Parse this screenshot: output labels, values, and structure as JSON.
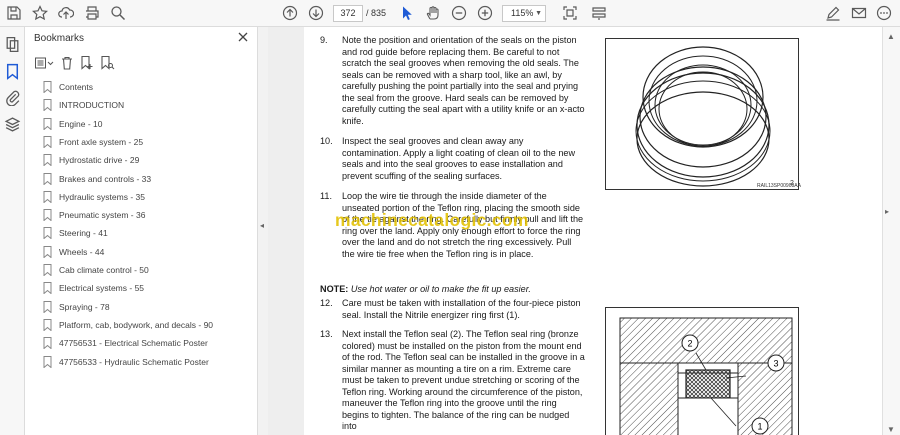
{
  "toolbar": {
    "page_current": "372",
    "page_total": "/ 835",
    "zoom": "115%"
  },
  "sidebar": {
    "title": "Bookmarks",
    "items": [
      {
        "label": "Contents"
      },
      {
        "label": "INTRODUCTION"
      },
      {
        "label": "Engine - 10"
      },
      {
        "label": "Front axle system - 25"
      },
      {
        "label": "Hydrostatic drive - 29"
      },
      {
        "label": "Brakes and controls - 33"
      },
      {
        "label": "Hydraulic systems - 35"
      },
      {
        "label": "Pneumatic system - 36"
      },
      {
        "label": "Steering - 41"
      },
      {
        "label": "Wheels - 44"
      },
      {
        "label": "Cab climate control - 50"
      },
      {
        "label": "Electrical systems - 55"
      },
      {
        "label": "Spraying - 78"
      },
      {
        "label": "Platform, cab, bodywork, and decals - 90"
      },
      {
        "label": "47756531 - Electrical Schematic Poster"
      },
      {
        "label": "47756533 - Hydraulic Schematic Poster"
      }
    ]
  },
  "document": {
    "steps": [
      {
        "num": "9.",
        "text": "Note the position and orientation of the seals on the piston and rod guide before replacing them. Be careful to not scratch the seal grooves when removing the old seals. The seals can be removed with a sharp tool, like an awl, by carefully pushing the point partially into the seal and prying the seal from the groove. Hard seals can be removed by carefully cutting the seal apart with a utility knife or an x-acto knife."
      },
      {
        "num": "10.",
        "text": "Inspect the seal grooves and clean away any contamination. Apply a light coating of clean oil to the new seals and into the seal grooves to ease installation and prevent scuffing of the sealing surfaces."
      },
      {
        "num": "11.",
        "text": "Loop the wire tie through the inside diameter of the unseated portion of the Teflon ring, placing the smooth side of the tie against the ring. Carefully but firmly pull and lift the ring over the land. Apply only enough effort to force the ring over the land and do not stretch the ring excessively. Pull the wire tie free when the Teflon ring is in place."
      },
      {
        "num": "12.",
        "text": "Care must be taken with installation of the four-piece piston seal. Install the Nitrile energizer ring first (1)."
      },
      {
        "num": "13.",
        "text": "Next install the Teflon seal (2). The Teflon seal ring (bronze colored) must be installed on the piston from the mount end of the rod. The Teflon seal can be installed in the groove in a similar manner as mounting a tire on a rim. Extreme care must be taken to prevent undue stretching or scoring of the Teflon ring. Working around the circumference of the piston, maneuver the Teflon ring into the groove until the ring begins to tighten. The balance of the ring can be nudged into"
      }
    ],
    "note_label": "NOTE:",
    "note_text": "Use hot water or oil to make the fit up easier.",
    "figure1_caption": "RAIL13SP00908AA",
    "figure1_number": "2",
    "figure2_callouts": [
      "2",
      "3",
      "1"
    ]
  },
  "watermark": "machinecatalogic.com"
}
